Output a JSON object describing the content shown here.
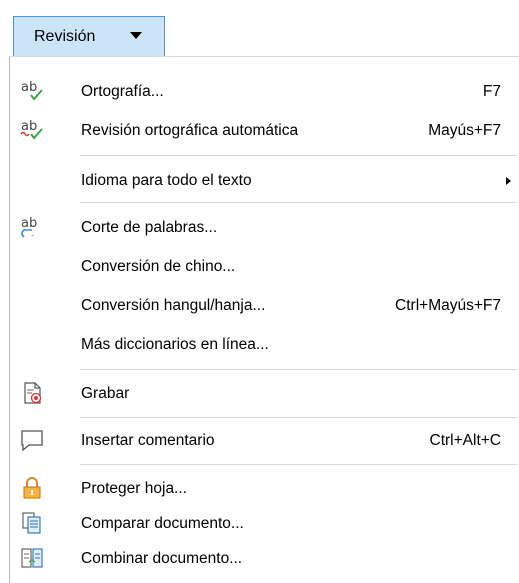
{
  "menu": {
    "title": "Revisión"
  },
  "items": [
    {
      "label": "Ortografía...",
      "shortcut": "F7",
      "icon": "spelling-icon"
    },
    {
      "label": "Revisión ortográfica automática",
      "shortcut": "Mayús+F7",
      "icon": "autospell-icon"
    },
    {
      "label": "Idioma para todo el texto",
      "shortcut": "",
      "icon": ""
    },
    {
      "label": "Corte de palabras...",
      "shortcut": "",
      "icon": "hyphenation-icon"
    },
    {
      "label": "Conversión de chino...",
      "shortcut": "",
      "icon": ""
    },
    {
      "label": "Conversión hangul/hanja...",
      "shortcut": "Ctrl+Mayús+F7",
      "icon": ""
    },
    {
      "label": "Más diccionarios en línea...",
      "shortcut": "",
      "icon": ""
    },
    {
      "label": "Grabar",
      "shortcut": "",
      "icon": "record-changes-icon"
    },
    {
      "label": "Insertar comentario",
      "shortcut": "Ctrl+Alt+C",
      "icon": "comment-icon"
    },
    {
      "label": "Proteger hoja...",
      "shortcut": "",
      "icon": "lock-icon"
    },
    {
      "label": "Comparar documento...",
      "shortcut": "",
      "icon": "compare-document-icon"
    },
    {
      "label": "Combinar documento...",
      "shortcut": "",
      "icon": "merge-document-icon"
    }
  ]
}
